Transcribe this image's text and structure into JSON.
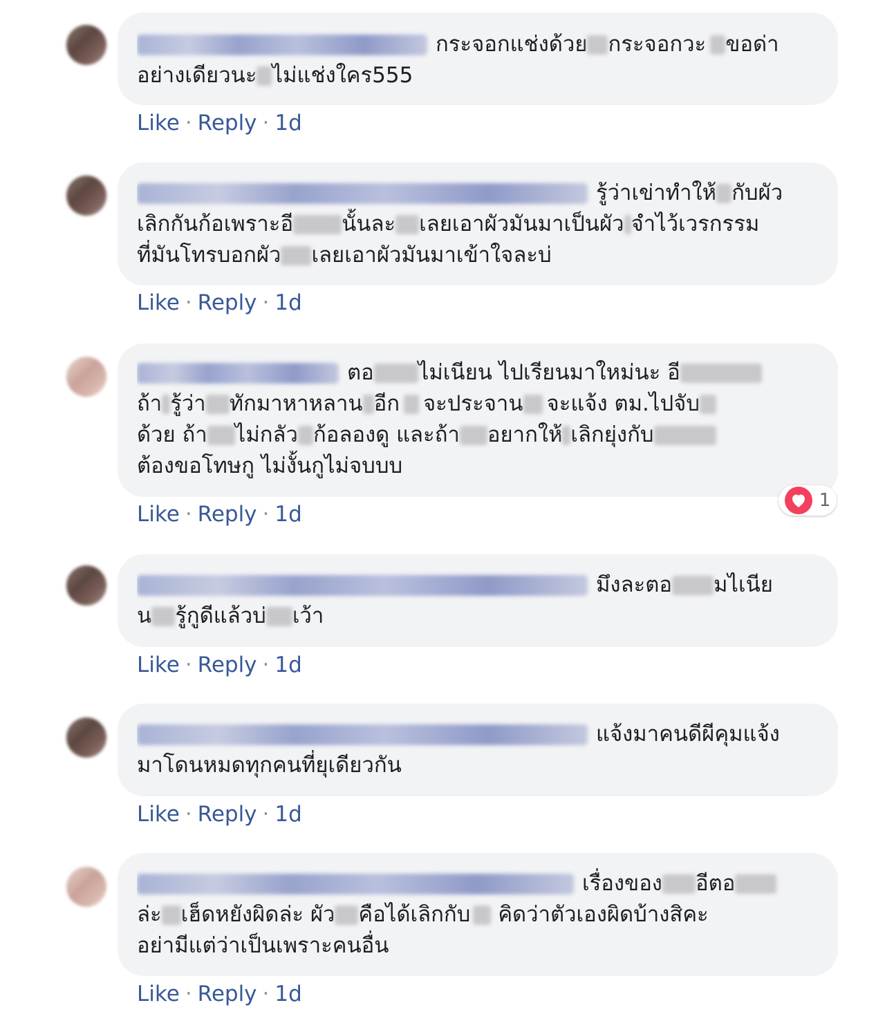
{
  "action_bar": {
    "like": "Like",
    "reply": "Reply",
    "separator": "·"
  },
  "comments": [
    {
      "lines": [
        "กระจอกแช่งด้วย",
        "กระจอกวะ",
        "ขอด่า",
        "อย่างเดียวนะ",
        "ไม่แช่งใคร555"
      ],
      "time": "1d"
    },
    {
      "lines": [
        "รู้ว่าเข่าทำให้",
        "กับผัว",
        "เลิกกันก้อเพราะอี",
        "นั้นละ",
        "เลยเอาผัวมันมาเป็นผัว",
        "จำไว้เวรกรรม",
        "ที่มันโทรบอกผัว",
        "เลยเอาผัวมันมาเข้าใจละบ่"
      ],
      "time": "1d"
    },
    {
      "lines": [
        "ตอ",
        "ไม่เนียน ไปเรียนมาใหม่นะ อี",
        "ถ้า",
        "รู้ว่า",
        "ทักมาหาหลาน",
        "อีก",
        "จะประจาน",
        "จะแจ้ง ตม.ไปจับ",
        "ด้วย ถ้า",
        "ไม่กลัว",
        "ก้อลองดู และถ้า",
        "อยากให้",
        "เลิกยุ่งกับ",
        "ต้องขอโทษกู ไม่งั้นกูไม่จบบบ"
      ],
      "time": "1d",
      "reaction_count": "1"
    },
    {
      "lines": [
        "มึงละตอ",
        "มไเนีย",
        "น",
        "รู้กูดีแล้วบ่",
        "เว้า"
      ],
      "time": "1d"
    },
    {
      "lines": [
        "แจ้งมาคนดีผีคุมแจ้ง",
        "มาโดนหมดทุกคนที่ยุเดียวกัน"
      ],
      "time": "1d"
    },
    {
      "lines": [
        "เรื่องของ",
        "อีตอ",
        "ล่ะ",
        "เฮ็ดหยังผิดล่ะ ผัว",
        "คือได้เลิกกับ",
        "คิดว่าตัวเองผิดบ้างสิคะ",
        "อย่ามีแต่ว่าเป็นเพราะคนอื่น"
      ],
      "time": "1d"
    }
  ],
  "colors": {
    "bubble": "#f2f3f5",
    "link": "#385898",
    "heart": "#f2405e"
  }
}
